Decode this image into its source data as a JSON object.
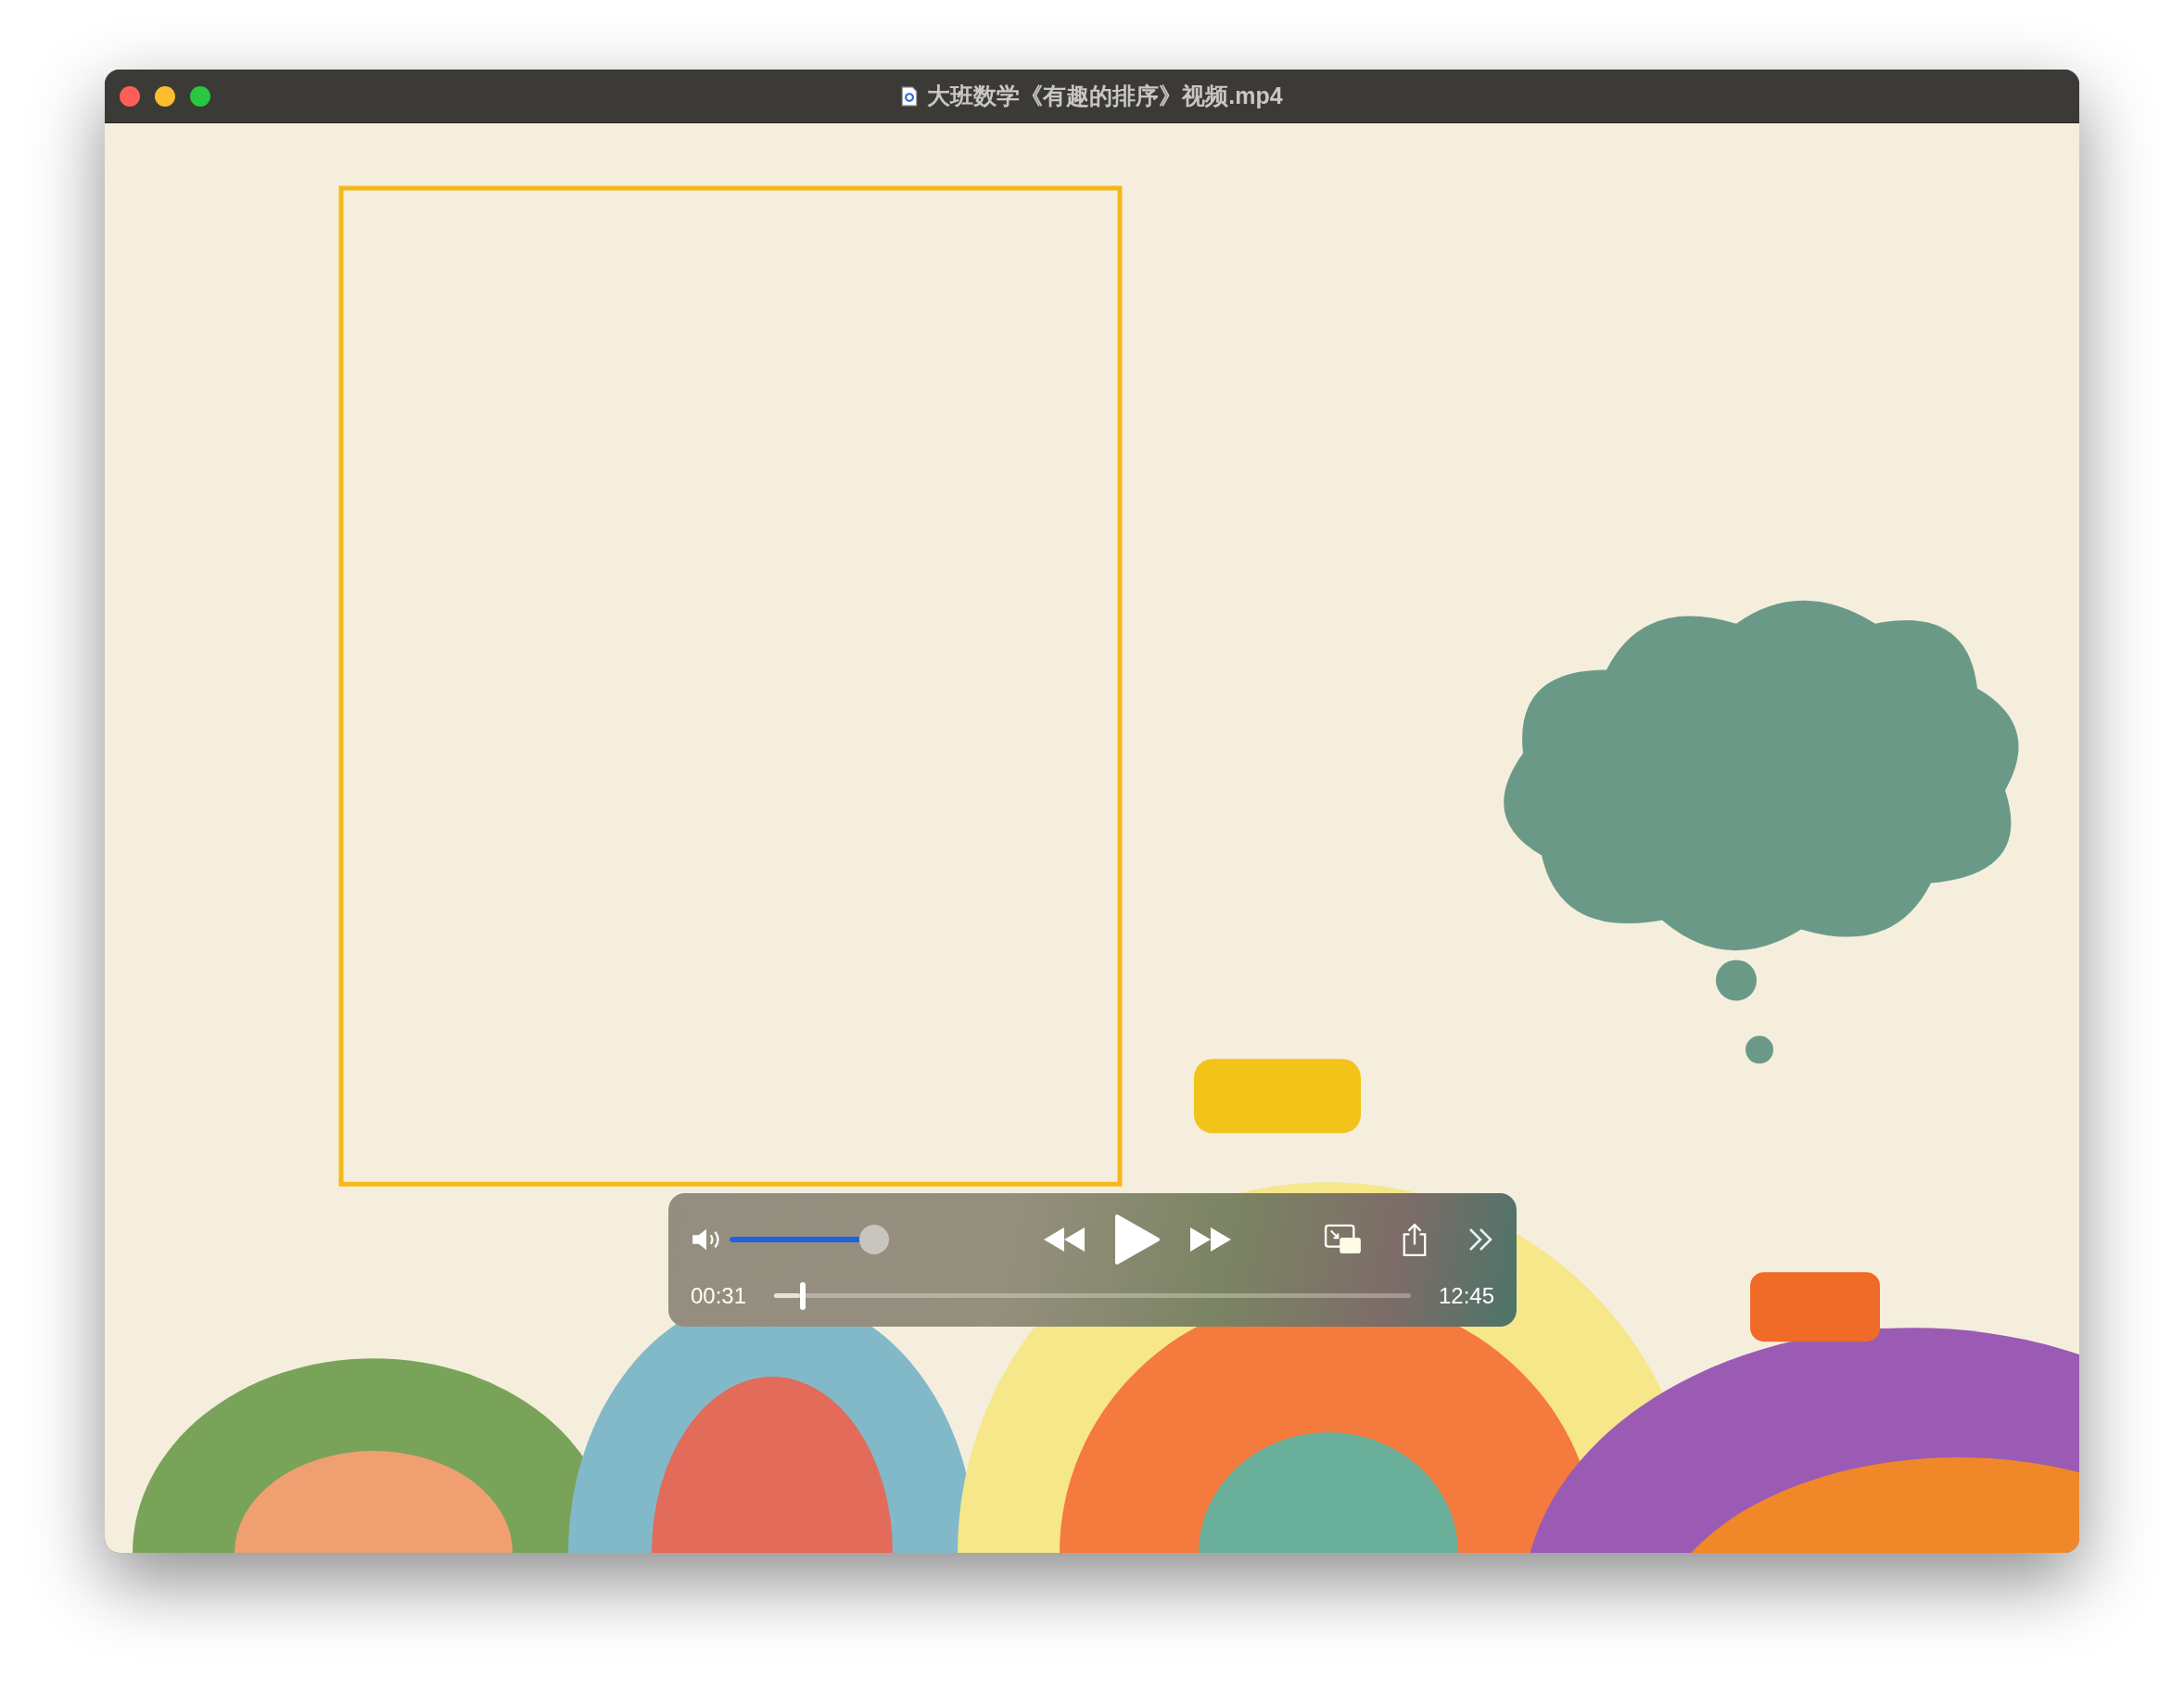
{
  "window": {
    "title": "大班数学《有趣的排序》视频.mp4"
  },
  "controls": {
    "volume": {
      "level": 1
    },
    "playing": false,
    "elapsed": "00:31",
    "duration": "12:45",
    "progress": {
      "level": 0.04
    }
  }
}
